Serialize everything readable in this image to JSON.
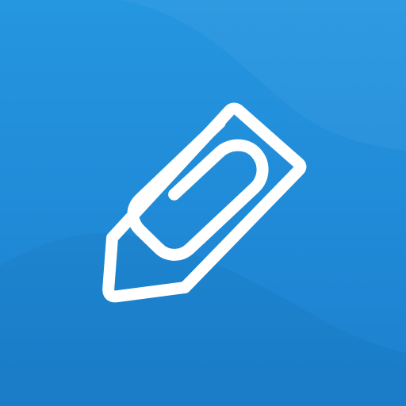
{
  "icon": {
    "name": "pencil-paperclip-icon",
    "background_colors": {
      "top": "#2596e0",
      "middle": "#208ad7",
      "bottom": "#1c80cf"
    },
    "glyph_color": "#ffffff"
  }
}
